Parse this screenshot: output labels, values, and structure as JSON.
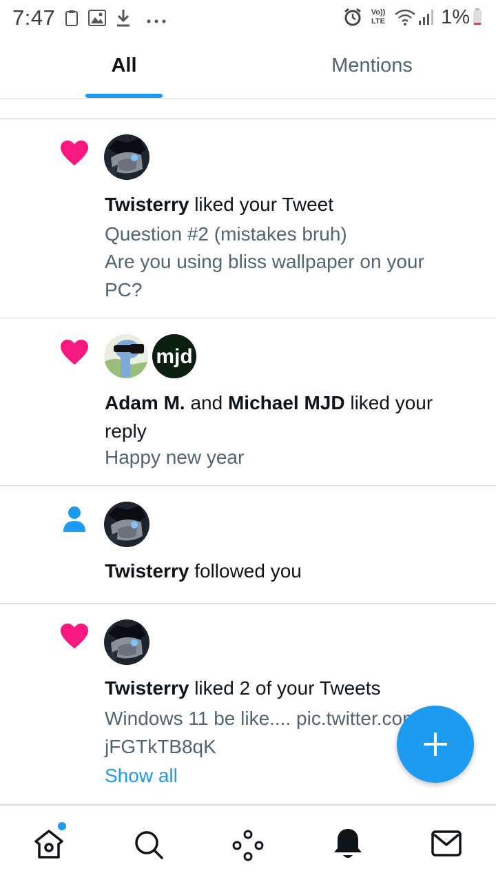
{
  "status_bar": {
    "time": "7:47",
    "network_label": "Vo)) LTE",
    "battery_percent": "1%"
  },
  "tabs": [
    {
      "label": "All",
      "selected": true
    },
    {
      "label": "Mentions",
      "selected": false
    }
  ],
  "notifications": [
    {
      "type": "like",
      "icon": "heart-icon",
      "actor": "Twisterry",
      "action": " liked your Tweet",
      "content_line1": "Question #2 (mistakes bruh)",
      "content_line2": "Are you using bliss wallpaper on your PC?"
    },
    {
      "type": "like",
      "icon": "heart-icon",
      "actor1": "Adam M.",
      "joiner": " and ",
      "actor2": "Michael MJD",
      "action": " liked your reply",
      "content": "Happy new year",
      "avatar2_text": "mjd"
    },
    {
      "type": "follow",
      "icon": "person-icon",
      "actor": "Twisterry",
      "action": " followed you"
    },
    {
      "type": "like",
      "icon": "heart-icon",
      "actor": "Twisterry",
      "action": " liked 2 of your Tweets",
      "content_line1": "Windows 11 be like.... pic.twitter.com/",
      "content_line2": "jFGTkTB8qK",
      "show_all": "Show all"
    }
  ],
  "fab": {
    "icon": "plus-icon"
  },
  "bottom_nav": [
    {
      "icon": "home-icon",
      "has_badge": true
    },
    {
      "icon": "search-icon"
    },
    {
      "icon": "spaces-icon"
    },
    {
      "icon": "bell-icon",
      "active": true
    },
    {
      "icon": "mail-icon"
    }
  ],
  "colors": {
    "accent": "#1d9bf0",
    "heart": "#f91880",
    "text_primary": "#0f1419",
    "text_secondary": "#536471",
    "divider": "#cfd9de"
  }
}
